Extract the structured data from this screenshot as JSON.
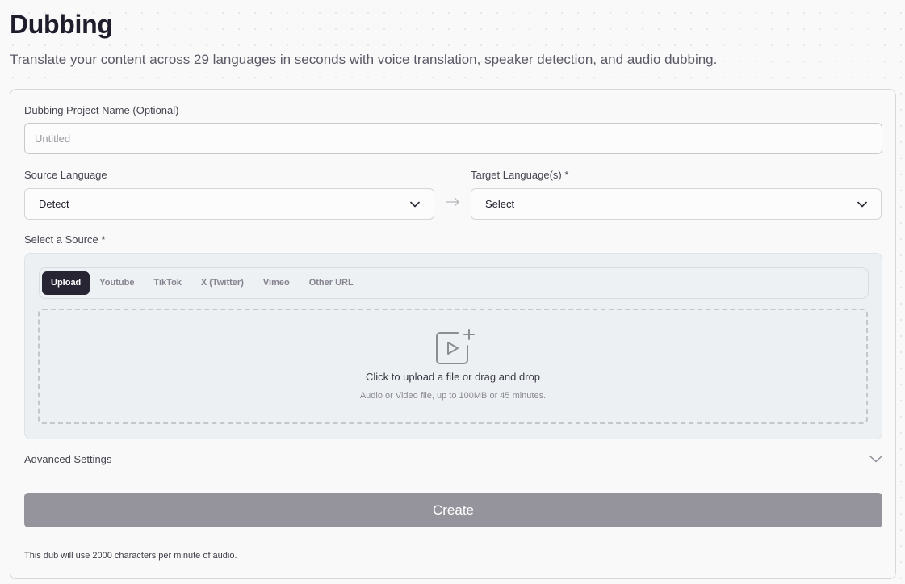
{
  "header": {
    "title": "Dubbing",
    "subtitle": "Translate your content across 29 languages in seconds with voice translation, speaker detection, and audio dubbing."
  },
  "form": {
    "project_name": {
      "label": "Dubbing Project Name (Optional)",
      "placeholder": "Untitled",
      "value": ""
    },
    "source_language": {
      "label": "Source Language",
      "value": "Detect"
    },
    "target_language": {
      "label": "Target Language(s)",
      "required_mark": "*",
      "value": "Select"
    },
    "source": {
      "label": "Select a Source",
      "required_mark": "*",
      "tabs": [
        {
          "label": "Upload",
          "active": true
        },
        {
          "label": "Youtube",
          "active": false
        },
        {
          "label": "TikTok",
          "active": false
        },
        {
          "label": "X (Twitter)",
          "active": false
        },
        {
          "label": "Vimeo",
          "active": false
        },
        {
          "label": "Other URL",
          "active": false
        }
      ],
      "dropzone": {
        "title": "Click to upload a file or drag and drop",
        "subtitle": "Audio or Video file, up to 100MB or 45 minutes.",
        "icon": "video-add-icon"
      }
    },
    "advanced_settings_label": "Advanced Settings",
    "create_label": "Create",
    "footnote": "This dub will use 2000 characters per minute of audio."
  },
  "colors": {
    "primary_dark": "#272433",
    "button_disabled": "#95949d",
    "background": "#f8f9f8"
  }
}
